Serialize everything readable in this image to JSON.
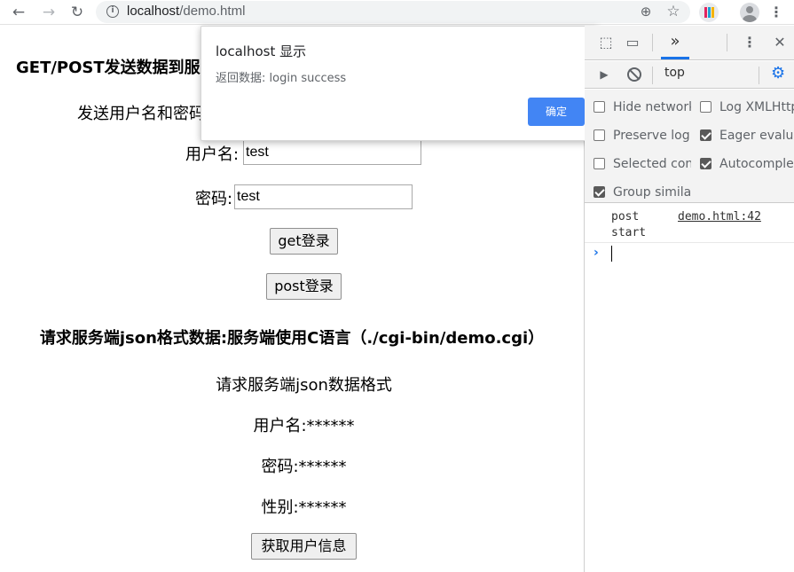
{
  "browser": {
    "url_host": "localhost",
    "url_path": "/demo.html",
    "icons": [
      "back-arrow-icon",
      "forward-arrow-icon",
      "reload-icon",
      "info-icon",
      "zoom-icon",
      "star-icon",
      "extension-icon",
      "profile-icon",
      "menu-icon"
    ],
    "glyphs": {
      "back": "←",
      "forward": "→",
      "reload": "↻",
      "info": "i",
      "zoom": "⊕",
      "star": "☆",
      "menu": "⋮"
    }
  },
  "page": {
    "heading1": "GET/POST发送数据到服务端",
    "subheading1": "发送用户名和密码",
    "username_label": "用户名:",
    "username_value": "test",
    "password_label": "密码:",
    "password_value": "test",
    "get_button": "get登录",
    "post_button": "post登录",
    "heading2": "请求服务端json格式数据:服务端使用C语言（./cgi-bin/demo.cgi）",
    "json_format_title": "请求服务端json数据格式",
    "json_username": "用户名:******",
    "json_password": "密码:******",
    "json_gender": "性别:******",
    "fetch_button": "获取用户信息"
  },
  "dialog": {
    "title": "localhost 显示",
    "message": "返回数据: login success",
    "ok_label": "确定",
    "ok_color": "#4285f4"
  },
  "devtools": {
    "tab_glyphs": {
      "inspect": "⬚",
      "device": "▭",
      "more_tabs": "»",
      "kebab": "⋮",
      "close": "✕"
    },
    "toolbar_glyphs": {
      "sidebar": "▶",
      "clear": "⃠",
      "gear": "⚙"
    },
    "context": "top",
    "settings": [
      {
        "label": "Hide network",
        "checked": false
      },
      {
        "label": "Log XMLHttpRequests",
        "checked": false
      },
      {
        "label": "Preserve log",
        "checked": false
      },
      {
        "label": "Eager evaluation",
        "checked": true
      },
      {
        "label": "Selected context only",
        "checked": false
      },
      {
        "label": "Autocomplete from history",
        "checked": true
      },
      {
        "label": "Group similar",
        "checked": true
      }
    ],
    "console": {
      "log_text": "post\nstart",
      "log_source": "demo.html:42",
      "prompt": "›"
    }
  }
}
